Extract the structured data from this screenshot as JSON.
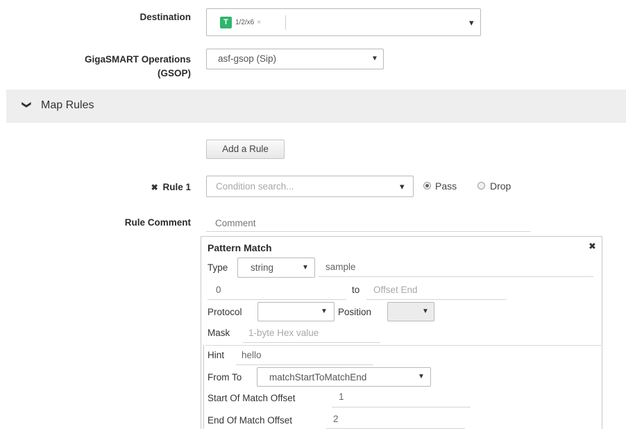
{
  "destination": {
    "label": "Destination",
    "tag_icon": "T",
    "tag_text": "1/2/x6",
    "tag_remove": "×",
    "dropdown_caret": "▾"
  },
  "gsop": {
    "label_line1": "GigaSMART Operations",
    "label_line2": "(GSOP)",
    "value": "asf-gsop (Sip)",
    "caret": "▼"
  },
  "map_rules": {
    "chevron": "❯",
    "title": "Map Rules"
  },
  "add_rule_label": "Add a Rule",
  "rule1": {
    "remove_icon": "✖",
    "label": "Rule 1",
    "condition_placeholder": "Condition search...",
    "caret": "▾",
    "pass_label": "Pass",
    "drop_label": "Drop",
    "selected": "Pass"
  },
  "rule_comment": {
    "label": "Rule Comment",
    "placeholder": "Comment"
  },
  "pattern_match": {
    "title": "Pattern Match",
    "close_icon": "✖",
    "type_label": "Type",
    "type_value": "string",
    "type_caret": "▼",
    "pattern_value": "sample",
    "offset_start": "0",
    "to_label": "to",
    "offset_end_placeholder": "Offset End",
    "protocol_label": "Protocol",
    "protocol_value": "",
    "protocol_caret": "▼",
    "position_label": "Position",
    "position_value": "",
    "position_caret": "▼",
    "mask_label": "Mask",
    "mask_placeholder": "1-byte Hex value",
    "hint_label": "Hint",
    "hint_value": "hello",
    "from_to_label": "From To",
    "from_to_value": "matchStartToMatchEnd",
    "from_to_caret": "▼",
    "start_offset_label": "Start Of Match Offset",
    "start_offset_value": "1",
    "end_offset_label": "End Of Match Offset",
    "end_offset_value": "2"
  },
  "colors": {
    "tag_green": "#2fb56b",
    "section_bar": "#eeeeee"
  }
}
